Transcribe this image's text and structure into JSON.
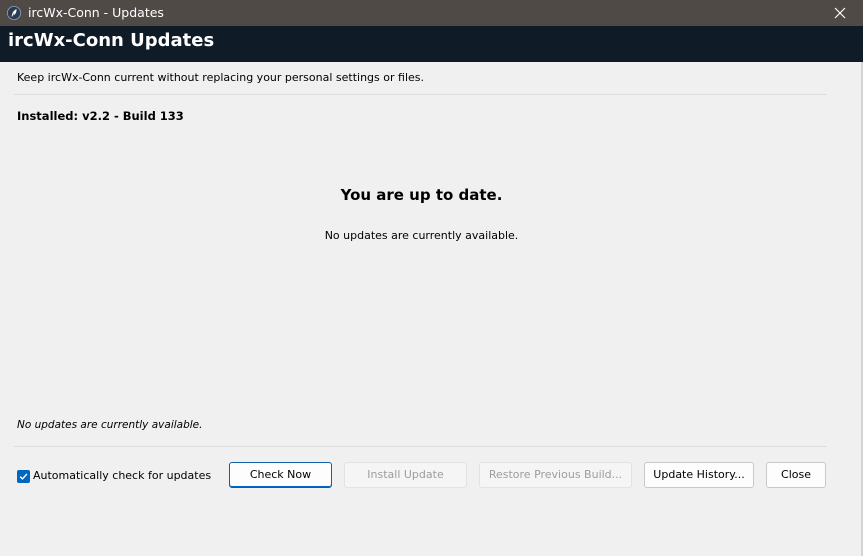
{
  "window": {
    "title": "ircWx-Conn - Updates",
    "close_symbol": "✕"
  },
  "banner": {
    "title": "ircWx-Conn Updates"
  },
  "content": {
    "description": "Keep ircWx-Conn current without replacing your personal settings or files.",
    "installed": "Installed: v2.2 - Build 133",
    "headline": "You are up to date.",
    "subline": "No updates are currently available.",
    "status": "No updates are currently available."
  },
  "footer": {
    "auto_check_label": "Automatically check for updates",
    "auto_check_checked": true,
    "buttons": {
      "check_now": "Check Now",
      "install_update": "Install Update",
      "restore_previous": "Restore Previous Build...",
      "update_history": "Update History...",
      "close": "Close"
    }
  },
  "icons": {
    "app": "feather-icon",
    "close": "close-icon",
    "check": "checkmark-icon"
  },
  "colors": {
    "titlebar": "#504a47",
    "banner": "#0f1b26",
    "accent": "#0067c0",
    "background": "#f0f0f0"
  }
}
